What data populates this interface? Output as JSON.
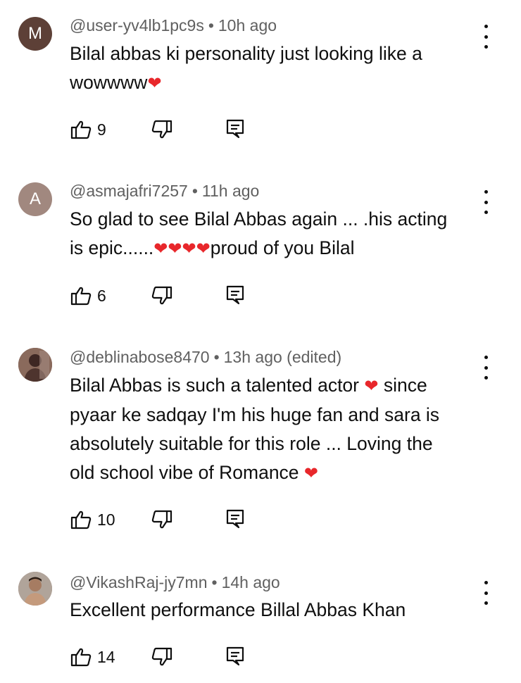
{
  "comments": [
    {
      "avatar_letter": "M",
      "avatar_color": "#5d4037",
      "handle": "@user-yv4lb1pc9s",
      "separator": "•",
      "time": "10h ago",
      "lines": [
        "Bilal abbas ki personality just looking like a",
        "wowwww"
      ],
      "hearts": [
        "❤"
      ],
      "likes": "9"
    },
    {
      "avatar_letter": "A",
      "avatar_color": "#a1887f",
      "handle": "@asmajafri7257",
      "separator": "•",
      "time": "11h ago",
      "lines": [
        "So glad to see Bilal Abbas again ... .his acting",
        "is epic......",
        "proud of you Bilal"
      ],
      "hearts": [
        "❤❤❤❤"
      ],
      "likes": "6"
    },
    {
      "avatar_color": "#6d4c41",
      "handle": "@deblinabose8470",
      "separator": "•",
      "time": "13h ago (edited)",
      "lines": [
        "Bilal Abbas is such a talented actor",
        "since",
        "pyaar ke sadqay I'm his huge fan and sara is",
        "absolutely suitable for this role ... Loving the",
        "old school vibe of Romance"
      ],
      "hearts": [
        "❤",
        "❤"
      ],
      "likes": "10"
    },
    {
      "avatar_color": "#8d6e63",
      "handle": "@VikashRaj-jy7mn",
      "separator": "•",
      "time": "14h ago",
      "lines": [
        "Excellent performance Billal Abbas Khan"
      ],
      "likes": "14"
    }
  ],
  "icons": {
    "like": "thumbs-up-icon",
    "dislike": "thumbs-down-icon",
    "reply": "reply-icon",
    "more": "more-vertical-icon"
  }
}
